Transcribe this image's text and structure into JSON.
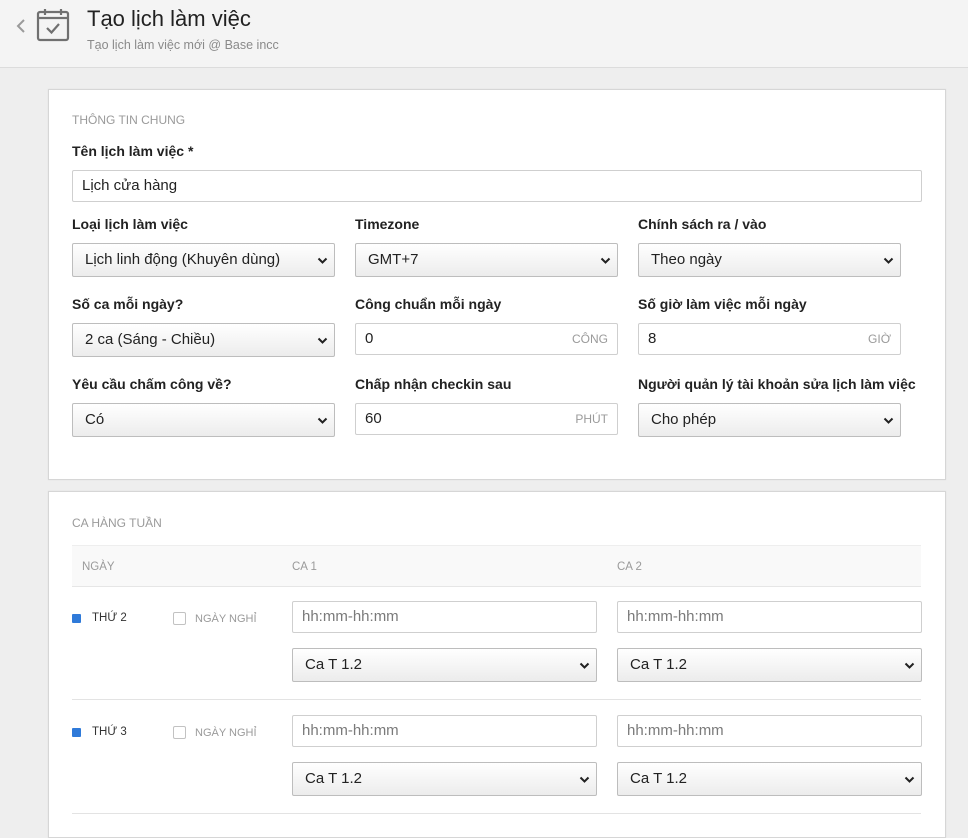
{
  "header": {
    "title": "Tạo lịch làm việc",
    "subtitle": "Tạo lịch làm việc mới @ Base incc"
  },
  "general": {
    "section_title": "Thông tin chung",
    "name_label": "Tên lịch làm việc *",
    "name_value": "Lịch cửa hàng",
    "schedule_type_label": "Loại lịch làm việc",
    "schedule_type_value": "Lịch linh động (Khuyên dùng)",
    "timezone_label": "Timezone",
    "timezone_value": "GMT+7",
    "policy_label": "Chính sách ra / vào",
    "policy_value": "Theo ngày",
    "shifts_label": "Số ca mỗi ngày?",
    "shifts_value": "2 ca (Sáng - Chiều)",
    "standard_label": "Công chuẩn mỗi ngày",
    "standard_value": "0",
    "standard_unit": "Công",
    "hours_label": "Số giờ làm việc mỗi ngày",
    "hours_value": "8",
    "hours_unit": "Giờ",
    "checkout_label": "Yêu cầu chấm công về?",
    "checkout_value": "Có",
    "late_label": "Chấp nhận checkin sau",
    "late_value": "60",
    "late_unit": "Phút",
    "manager_label": "Người quản lý tài khoản sửa lịch làm việc",
    "manager_value": "Cho phép"
  },
  "weekly": {
    "section_title": "Ca hàng tuần",
    "col_day": "Ngày",
    "col_shift1": "Ca 1",
    "col_shift2": "Ca 2",
    "dayoff_label": "Ngày nghỉ",
    "time_placeholder": "hh:mm-hh:mm",
    "rows": [
      {
        "day": "Thứ 2",
        "shift1_select": "Ca T 1.2",
        "shift2_select": "Ca T 1.2"
      },
      {
        "day": "Thứ 3",
        "shift1_select": "Ca T 1.2",
        "shift2_select": "Ca T 1.2"
      }
    ]
  },
  "colors": {
    "accent": "#2f7ad9"
  },
  "icons": [
    "chevron-left-icon",
    "calendar-check-icon",
    "chevron-down-icon"
  ]
}
